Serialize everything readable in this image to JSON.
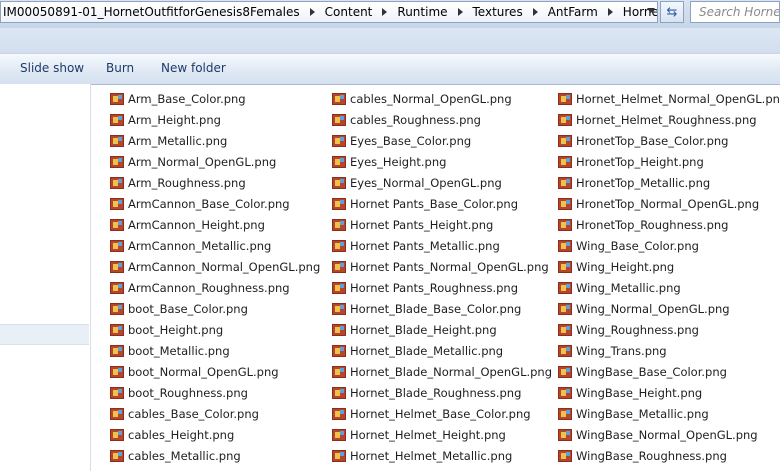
{
  "address": {
    "crumbs": [
      "IM00050891-01_HornetOutfitforGenesis8Females",
      "Content",
      "Runtime",
      "Textures",
      "AntFarm",
      "Hornet"
    ],
    "search_placeholder": "Search Hornet"
  },
  "toolbar": {
    "slide_show": "Slide show",
    "burn": "Burn",
    "new_folder": "New folder"
  },
  "files": {
    "col1": [
      "Arm_Base_Color.png",
      "Arm_Height.png",
      "Arm_Metallic.png",
      "Arm_Normal_OpenGL.png",
      "Arm_Roughness.png",
      "ArmCannon_Base_Color.png",
      "ArmCannon_Height.png",
      "ArmCannon_Metallic.png",
      "ArmCannon_Normal_OpenGL.png",
      "ArmCannon_Roughness.png",
      "boot_Base_Color.png",
      "boot_Height.png",
      "boot_Metallic.png",
      "boot_Normal_OpenGL.png",
      "boot_Roughness.png",
      "cables_Base_Color.png",
      "cables_Height.png",
      "cables_Metallic.png"
    ],
    "col2": [
      "cables_Normal_OpenGL.png",
      "cables_Roughness.png",
      "Eyes_Base_Color.png",
      "Eyes_Height.png",
      "Eyes_Normal_OpenGL.png",
      "Hornet Pants_Base_Color.png",
      "Hornet Pants_Height.png",
      "Hornet Pants_Metallic.png",
      "Hornet Pants_Normal_OpenGL.png",
      "Hornet Pants_Roughness.png",
      "Hornet_Blade_Base_Color.png",
      "Hornet_Blade_Height.png",
      "Hornet_Blade_Metallic.png",
      "Hornet_Blade_Normal_OpenGL.png",
      "Hornet_Blade_Roughness.png",
      "Hornet_Helmet_Base_Color.png",
      "Hornet_Helmet_Height.png",
      "Hornet_Helmet_Metallic.png"
    ],
    "col3": [
      "Hornet_Helmet_Normal_OpenGL.png",
      "Hornet_Helmet_Roughness.png",
      "HronetTop_Base_Color.png",
      "HronetTop_Height.png",
      "HronetTop_Metallic.png",
      "HronetTop_Normal_OpenGL.png",
      "HronetTop_Roughness.png",
      "Wing_Base_Color.png",
      "Wing_Height.png",
      "Wing_Metallic.png",
      "Wing_Normal_OpenGL.png",
      "Wing_Roughness.png",
      "Wing_Trans.png",
      "WingBase_Base_Color.png",
      "WingBase_Height.png",
      "WingBase_Metallic.png",
      "WingBase_Normal_OpenGL.png",
      "WingBase_Roughness.png"
    ]
  }
}
